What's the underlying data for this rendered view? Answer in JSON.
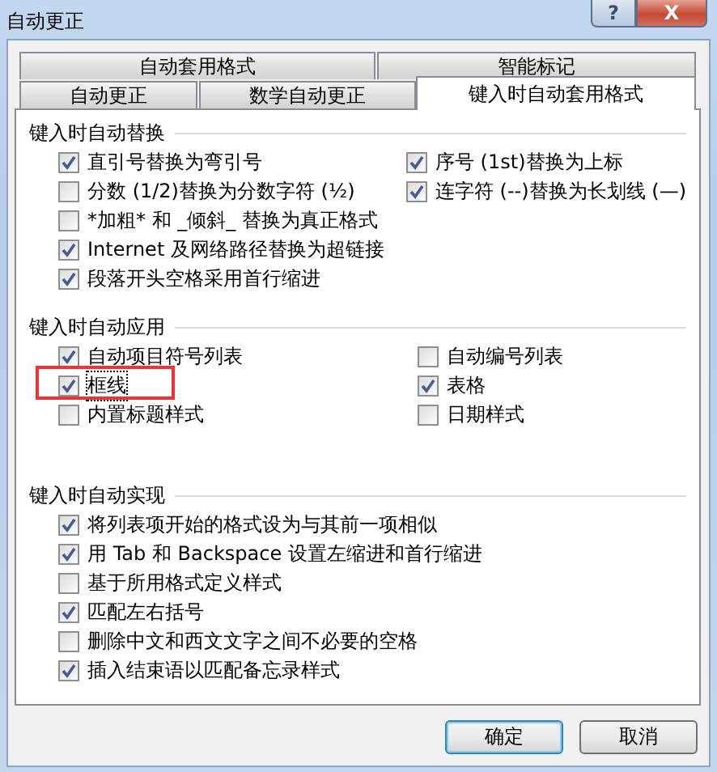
{
  "window": {
    "title": "自动更正",
    "help_button": "?",
    "close_button": "X"
  },
  "tab_rows": [
    [
      {
        "label": "自动套用格式",
        "selected": false
      },
      {
        "label": "智能标记",
        "selected": false
      }
    ],
    [
      {
        "label": "自动更正",
        "selected": false
      },
      {
        "label": "数学自动更正",
        "selected": false
      },
      {
        "label": "键入时自动套用格式",
        "selected": true
      }
    ]
  ],
  "sections": [
    {
      "title": "键入时自动替换",
      "columns": [
        [
          {
            "label": "直引号替换为弯引号",
            "checked": true,
            "highlighted": false
          },
          {
            "label": "分数 (1/2)替换为分数字符 (½)",
            "checked": false,
            "highlighted": false
          },
          {
            "label": "*加粗* 和 _倾斜_ 替换为真正格式",
            "checked": false,
            "highlighted": false
          },
          {
            "label": "Internet 及网络路径替换为超链接",
            "checked": true,
            "highlighted": false
          },
          {
            "label": "段落开头空格采用首行缩进",
            "checked": true,
            "highlighted": false
          }
        ],
        [
          {
            "label": "序号 (1st)替换为上标",
            "checked": true,
            "highlighted": false
          },
          {
            "label": "连字符 (--)替换为长划线 (—)",
            "checked": true,
            "highlighted": false
          }
        ]
      ]
    },
    {
      "title": "键入时自动应用",
      "columns": [
        [
          {
            "label": "自动项目符号列表",
            "checked": true,
            "highlighted": false
          },
          {
            "label": "框线",
            "checked": true,
            "highlighted": true
          },
          {
            "label": "内置标题样式",
            "checked": false,
            "highlighted": false
          }
        ],
        [
          {
            "label": "自动编号列表",
            "checked": false,
            "highlighted": false
          },
          {
            "label": "表格",
            "checked": true,
            "highlighted": false
          },
          {
            "label": "日期样式",
            "checked": false,
            "highlighted": false
          }
        ]
      ]
    },
    {
      "title": "键入时自动实现",
      "columns": [
        [
          {
            "label": "将列表项开始的格式设为与其前一项相似",
            "checked": true,
            "highlighted": false
          },
          {
            "label": "用 Tab 和 Backspace 设置左缩进和首行缩进",
            "checked": true,
            "highlighted": false
          },
          {
            "label": "基于所用格式定义样式",
            "checked": false,
            "highlighted": false
          },
          {
            "label": "匹配左右括号",
            "checked": true,
            "highlighted": false
          },
          {
            "label": "删除中文和西文文字之间不必要的空格",
            "checked": false,
            "highlighted": false
          },
          {
            "label": "插入结束语以匹配备忘录样式",
            "checked": true,
            "highlighted": false
          }
        ]
      ]
    }
  ],
  "buttons": [
    {
      "label": "确定",
      "default": true
    },
    {
      "label": "取消",
      "default": false
    }
  ]
}
